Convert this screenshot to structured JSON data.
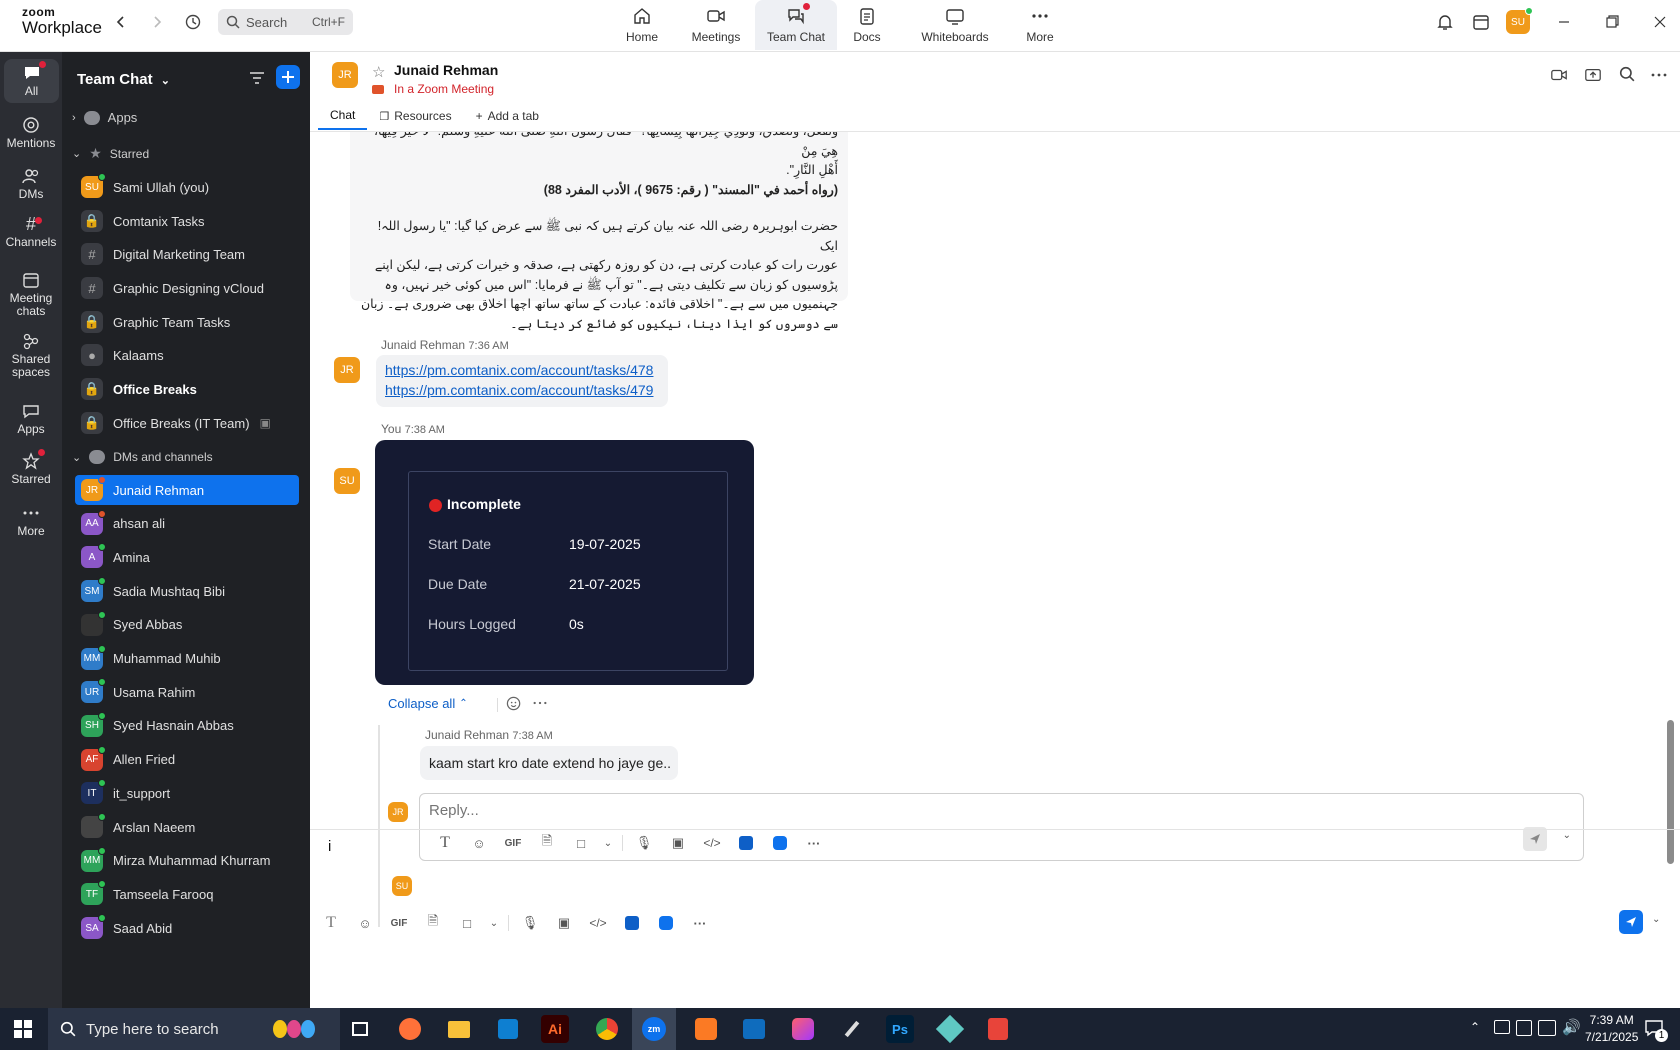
{
  "app": {
    "brand_top": "zoom",
    "brand_bottom": "Workplace"
  },
  "search": {
    "placeholder": "Search",
    "shortcut": "Ctrl+F"
  },
  "nav_tabs": [
    {
      "label": "Home"
    },
    {
      "label": "Meetings"
    },
    {
      "label": "Team Chat"
    },
    {
      "label": "Docs"
    },
    {
      "label": "Whiteboards"
    },
    {
      "label": "More"
    }
  ],
  "user": {
    "initials": "SU"
  },
  "rail": [
    {
      "label": "All"
    },
    {
      "label": "Mentions"
    },
    {
      "label": "DMs"
    },
    {
      "label": "Channels"
    },
    {
      "label_1": "Meeting",
      "label_2": "chats"
    },
    {
      "label_1": "Shared",
      "label_2": "spaces"
    },
    {
      "label": "Apps"
    },
    {
      "label": "Starred"
    },
    {
      "label": "More"
    }
  ],
  "sidebar": {
    "title": "Team Chat",
    "apps_label": "Apps",
    "starred_label": "Starred",
    "dms_label": "DMs and channels",
    "starred": [
      {
        "label": "Sami Ullah (you)",
        "initials": "SU",
        "color": "#f09a1a"
      },
      {
        "label": "Comtanix Tasks"
      },
      {
        "label": "Digital Marketing Team"
      },
      {
        "label": "Graphic Designing vCloud"
      },
      {
        "label": "Graphic Team Tasks"
      },
      {
        "label": "Kalaams"
      },
      {
        "label": "Office Breaks"
      },
      {
        "label": "Office Breaks (IT Team)"
      }
    ],
    "dms": [
      {
        "label": "Junaid Rehman",
        "initials": "JR",
        "color": "#f09a1a"
      },
      {
        "label": "ahsan ali",
        "initials": "AA",
        "color": "#8b57c7"
      },
      {
        "label": "Amina",
        "initials": "A",
        "color": "#8b57c7"
      },
      {
        "label": "Sadia Mushtaq Bibi",
        "initials": "SM",
        "color": "#2f7cc9"
      },
      {
        "label": "Syed Abbas",
        "initials": "",
        "color": "#333333"
      },
      {
        "label": "Muhammad Muhib",
        "initials": "MM",
        "color": "#2f7cc9"
      },
      {
        "label": "Usama Rahim",
        "initials": "UR",
        "color": "#2f7cc9"
      },
      {
        "label": "Syed Hasnain Abbas",
        "initials": "SH",
        "color": "#2ea35a"
      },
      {
        "label": "Allen Fried",
        "initials": "AF",
        "color": "#d8442f"
      },
      {
        "label": "it_support",
        "initials": "IT",
        "color": "#1d2f5e"
      },
      {
        "label": "Arslan Naeem",
        "initials": "",
        "color": "#444444"
      },
      {
        "label": "Mirza Muhammad Khurram",
        "initials": "MM",
        "color": "#2ea35a"
      },
      {
        "label": "Tamseela Farooq",
        "initials": "TF",
        "color": "#2ea35a"
      },
      {
        "label": "Saad Abid",
        "initials": "SA",
        "color": "#8b57c7"
      }
    ]
  },
  "chat": {
    "avatar_initials": "JR",
    "name": "Junaid Rehman",
    "status": "In a Zoom Meeting",
    "tabs": [
      "Chat",
      "Resources",
      "Add a tab"
    ]
  },
  "messages": {
    "urdu_block": {
      "line0": "وَتَفْعَلُ، وَتَصَدَّقُ، وَتُؤْذِي جِيرَانَهَا بِلِسَانِهَا؟\" فَقَالَ رَسُولُ اللَّهِ صَلَّى اللَّهُ عَلَيْهِ وَسَلَّمَ: \"لَا خَيْرَ فِيهَا، هِيَ مِنْ",
      "line1": "أَهْلِ النَّارِ\".",
      "ref": "(رواه أحمد في \"المسند\" ( رقم: 9675 )، الأدب المفرد 88)",
      "p1": "حضرت ابوہریرہ رضی اللہ عنہ بیان کرتے ہیں کہ نبی ﷺ سے عرض کیا گیا: \"یا رسول اللہ! ایک",
      "p2": "عورت رات کو عبادت کرتی ہے، دن کو روزہ رکھتی ہے، صدقہ و خیرات کرتی ہے، لیکن اپنے",
      "p3": "پڑوسیوں کو زبان سے تکلیف دیتی ہے۔\" تو آپ ﷺ نے فرمایا: \"اس میں کوئی خیر نہیں، وہ",
      "p4": "جہنمیوں میں سے ہے۔\" اخلاقی فائدہ: عبادت کے ساتھ ساتھ اچھا اخلاق بھی ضروری ہے۔ زبان",
      "p5": "سے دوسروں کو ایذا دینا، نیکیوں کو ضائع کر دیتا ہے۔"
    },
    "msg1": {
      "sender": "Junaid Rehman",
      "time": "7:36 AM",
      "initials": "JR",
      "link1": "https://pm.comtanix.com/account/tasks/478",
      "link2": "https://pm.comtanix.com/account/tasks/479"
    },
    "msg2": {
      "sender": "You",
      "time": "7:38 AM",
      "initials": "SU",
      "card": {
        "status": "Incomplete",
        "start_label": "Start Date",
        "start_value": "19-07-2025",
        "due_label": "Due Date",
        "due_value": "21-07-2025",
        "hours_label": "Hours Logged",
        "hours_value": "0s"
      }
    },
    "thread": {
      "collapse_label": "Collapse all",
      "reply_sender": "Junaid Rehman",
      "reply_time": "7:38 AM",
      "reply_initials": "JR",
      "reply_text": "kaam start kro date extend ho jaye ge..",
      "reply_placeholder": "Reply...",
      "me_initials": "SU"
    }
  },
  "composer": {
    "text": "i"
  },
  "taskbar": {
    "search_placeholder": "Type here to search",
    "time": "7:39 AM",
    "date": "7/21/2025",
    "notif_count": "1"
  }
}
